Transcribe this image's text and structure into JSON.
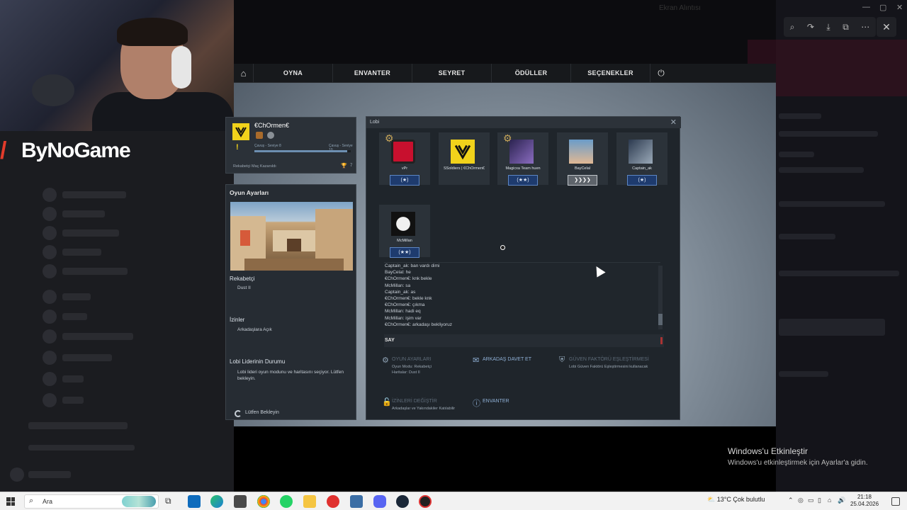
{
  "viewer": {
    "dim_title": "Ekran Alıntısı",
    "tools": [
      "⌕",
      "↷",
      "⤓",
      "⧉",
      "⋯"
    ],
    "close_icon": "✕",
    "window_controls": [
      "—",
      "▢",
      "✕"
    ]
  },
  "brand": {
    "mark": "/",
    "text": "ByNoGame"
  },
  "game": {
    "nav": {
      "home_icon": "⌂",
      "items": [
        "OYNA",
        "ENVANTER",
        "SEYRET",
        "ÖDÜLLER",
        "SEÇENEKLER"
      ],
      "power_icon": "⏻"
    },
    "profile": {
      "name": "€ChOrmen€",
      "warn_icon": "!",
      "rank_left": "Çavuş - Seviye 8",
      "rank_right": "Çavuş - Seviye 10",
      "rank_progress": 0.96,
      "wins_label": "Rekabetçi Maç Kazanıldı",
      "wins_count": "7"
    },
    "settings": {
      "title": "Oyun Ayarları",
      "mode_label": "Rekabetçi",
      "mode_value": "Dust II",
      "perm_label": "İzinler",
      "perm_value": "Arkadaşlara Açık",
      "leader_label": "Lobi Liderinin Durumu",
      "leader_text": "Lobi lideri oyun modunu ve haritasını seçiyor. Lütfen bekleyin.",
      "wait_text": "Lütfen Bekleyin"
    },
    "lobby": {
      "title": "Lobi",
      "close_icon": "✕",
      "players": [
        {
          "name": "vPr",
          "rank": "(★)",
          "color": "#c8102e",
          "rank_style": "gold"
        },
        {
          "name": "SSoldiers | €ChOrmen€",
          "rank": "",
          "color": "#f1d21b",
          "rank_style": "none"
        },
        {
          "name": "Magicxa Team huen",
          "rank": "(★★)",
          "color": "#6a4c9c",
          "rank_style": "gold"
        },
        {
          "name": "BayCelal",
          "rank": "❯❯❯❯",
          "color": "#c7a07a",
          "rank_style": "silver"
        },
        {
          "name": "Captain_ak",
          "rank": "(★)",
          "color": "#55657a",
          "rank_style": "gold"
        },
        {
          "name": "McMillan",
          "rank": "(★★)",
          "color": "#e6e6e6",
          "rank_style": "gold"
        }
      ],
      "chat": [
        "Captain_ak: ban vardı dimi",
        "BayCelal: he",
        "€ChOrmen€: knk bekle",
        "McMillan: sa",
        "Captain_ak: as",
        "€ChOrmen€: bekle knk",
        "€ChOrmen€: çıkma",
        "McMillan: hadi eq",
        "McMillan: işim var",
        "€ChOrmen€: arkadaşı bekliyoruz"
      ],
      "say_label": "SAY",
      "actions": {
        "settings_label": "OYUN AYARLARI",
        "settings_sub1": "Oyun Modu: Rekabetçi",
        "settings_sub2": "Haritalar: Dust II",
        "invite_label": "ARKADAŞ DAVET ET",
        "trust_label": "GÜVEN FAKTÖRÜ EŞLEŞTİRMESİ",
        "trust_sub": "Lobi Güven Faktörü Eşleştirmesini kullanacak",
        "perm_label": "İZİNLERİ DEĞİŞTİR",
        "perm_sub": "Arkadaşlar ve Yakındakiler Katılabilir",
        "inventory_label": "ENVANTER"
      }
    }
  },
  "activate": {
    "title": "Windows'u Etkinleştir",
    "sub": "Windows'u etkinleştirmek için Ayarlar'a gidin."
  },
  "taskbar": {
    "search_placeholder": "Ara",
    "weather": "13°C  Çok bulutlu",
    "time": "21:18",
    "date": "25.04.2026"
  }
}
